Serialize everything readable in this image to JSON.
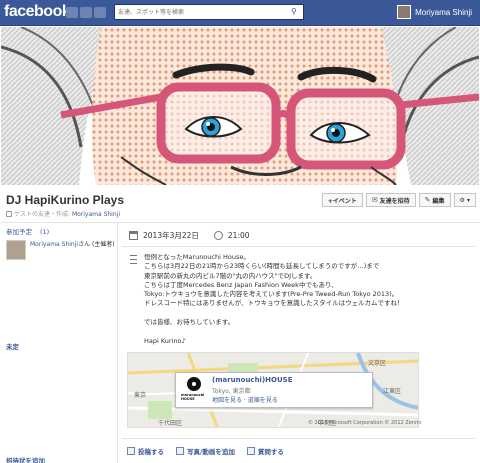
{
  "topbar": {
    "logo": "facebook",
    "search_placeholder": "友達、スポット等を検索",
    "user_name": "Moriyama Shinji"
  },
  "event": {
    "title": "DJ HapiKurino Plays",
    "subtitle_prefix": "ゲストの友達・作成: ",
    "host_link": "Moriyama Shinji",
    "actions": {
      "event_label": "+イベント",
      "invite_label": "友達を招待",
      "edit_label": "編集",
      "settings_label": "⚙ ▾"
    }
  },
  "left": {
    "going_heading": "参加予定",
    "going_count": "(1)",
    "attendee_name": "Moriyama Shinji",
    "attendee_suffix": "さん (主催者)",
    "undecided_heading": "未定",
    "invite_heading": "招待状を追加"
  },
  "details": {
    "date": "2013年3月22日",
    "time": "21:00",
    "description": "恒例となったMarunouchi House。\nこちらは3月22日の21時から23時くらい(時間も延長してしまうのですが…)まで\n東京駅前の新丸の内ビル7階の\"丸の内ハウス\"でDJします。\nこちらは丁度Mercedes Benz Japan Fashion Week中でもあり、\nTokyo:トウキョウを意識した内容を考えています(Pre-Pre Tweed-Run Tokyo 2013)。\nドレスコード特にはありませんが、トウキョウを意識したスタイルはウェルカムですね！\n\nでは皆様、お待ちしています。\n\nHapi Kurino♪"
  },
  "map": {
    "place_name": "(marunouchi)HOUSE",
    "place_location": "Tokyo, 東京都",
    "place_links": "地図を見る · 道順を見る",
    "logo_text": "marunouchi HOUSE",
    "copyright": "© 2013 Microsoft Corporation © 2012 Zenrin",
    "labels": [
      "東京",
      "文京区",
      "千代田区",
      "中央区",
      "江東区"
    ]
  },
  "composer": {
    "post_label": "投稿する",
    "photo_label": "写真/動画を追加",
    "question_label": "質問する"
  },
  "colors": {
    "brand": "#3b5998",
    "link": "#3b5998",
    "glasses": "#d6567a",
    "eyes": "#2aa3d8"
  }
}
